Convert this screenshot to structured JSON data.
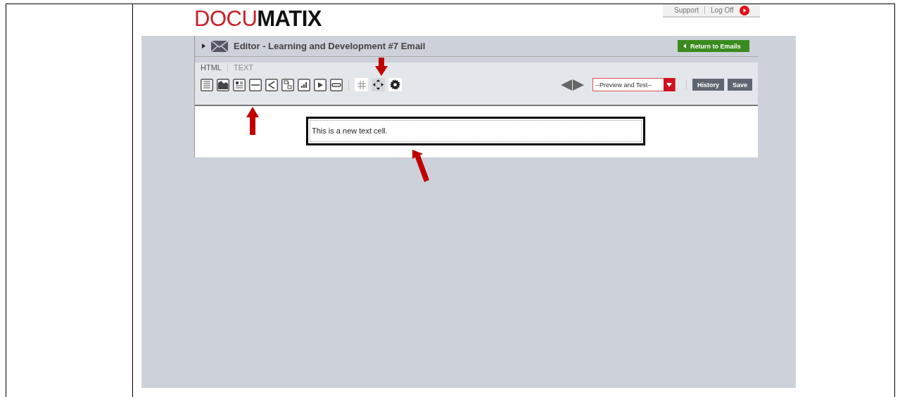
{
  "logo": {
    "light": "DOCU",
    "bold": "MATIX"
  },
  "top_links": [
    "Support",
    "Log Off"
  ],
  "editor": {
    "title": "Editor - Learning and Development #7 Email",
    "return_button": "Return to Emails"
  },
  "mode_tabs": [
    {
      "label": "HTML",
      "selected": true
    },
    {
      "label": "TEXT",
      "selected": false
    }
  ],
  "preview_select": {
    "value": "--Preview and Test--"
  },
  "buttons": [
    "History",
    "Save"
  ],
  "text_cell": "This is a new text cell."
}
